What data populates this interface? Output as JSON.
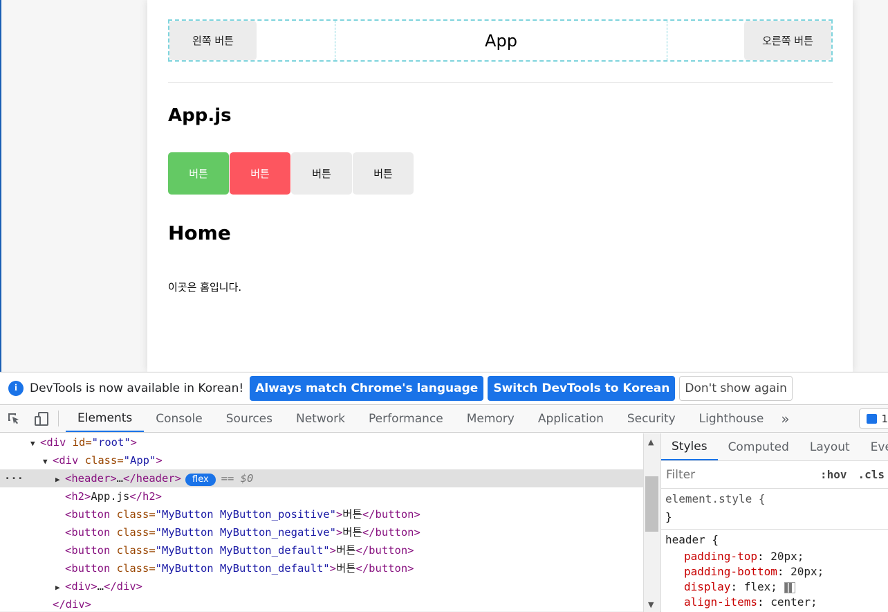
{
  "app": {
    "header": {
      "left_button": "왼쪽 버튼",
      "title": "App",
      "right_button": "오른쪽 버튼"
    },
    "section_title": "App.js",
    "buttons": [
      {
        "label": "버튼",
        "type": "positive"
      },
      {
        "label": "버튼",
        "type": "negative"
      },
      {
        "label": "버튼",
        "type": "default"
      },
      {
        "label": "버튼",
        "type": "default"
      }
    ],
    "home_title": "Home",
    "home_text": "이곳은 홈입니다."
  },
  "infobar": {
    "message": "DevTools is now available in Korean!",
    "btn_match": "Always match Chrome's language",
    "btn_switch": "Switch DevTools to Korean",
    "btn_dismiss": "Don't show again"
  },
  "tabs": [
    "Elements",
    "Console",
    "Sources",
    "Network",
    "Performance",
    "Memory",
    "Application",
    "Security",
    "Lighthouse"
  ],
  "issues_count": "1",
  "dom": {
    "l1_open": "<div",
    "l1_attr": " id=",
    "l1_val": "\"root\"",
    "l1_close": ">",
    "l2_open": "<div",
    "l2_attr": " class=",
    "l2_val": "\"App\"",
    "l2_close": ">",
    "l3_tag": "<header>",
    "l3_ellipsis": "…",
    "l3_end": "</header>",
    "l3_badge": "flex",
    "l3_eq": "== $0",
    "l4_open": "<h2>",
    "l4_text": "App.js",
    "l4_close": "</h2>",
    "btn_open": "<button",
    "btn_attr": " class=",
    "btn1_val": "\"MyButton MyButton_positive\"",
    "btn2_val": "\"MyButton MyButton_negative\"",
    "btn3_val": "\"MyButton MyButton_default\"",
    "btn4_val": "\"MyButton MyButton_default\"",
    "btn_gt": ">",
    "btn_text": "버튼",
    "btn_close": "</button>",
    "l9_open": "<div>",
    "l9_ellipsis": "…",
    "l9_close": "</div>",
    "l10_close": "</div>"
  },
  "styles": {
    "tabs": [
      "Styles",
      "Computed",
      "Layout",
      "Event"
    ],
    "filter_placeholder": "Filter",
    "hov": ":hov",
    "cls": ".cls",
    "element_style": "element.style {",
    "close_brace": "}",
    "header_rule": "header {",
    "props": [
      {
        "name": "padding-top",
        "value": "20px;"
      },
      {
        "name": "padding-bottom",
        "value": "20px;"
      },
      {
        "name": "display",
        "value": "flex;"
      },
      {
        "name": "align-items",
        "value": "center;"
      }
    ]
  }
}
